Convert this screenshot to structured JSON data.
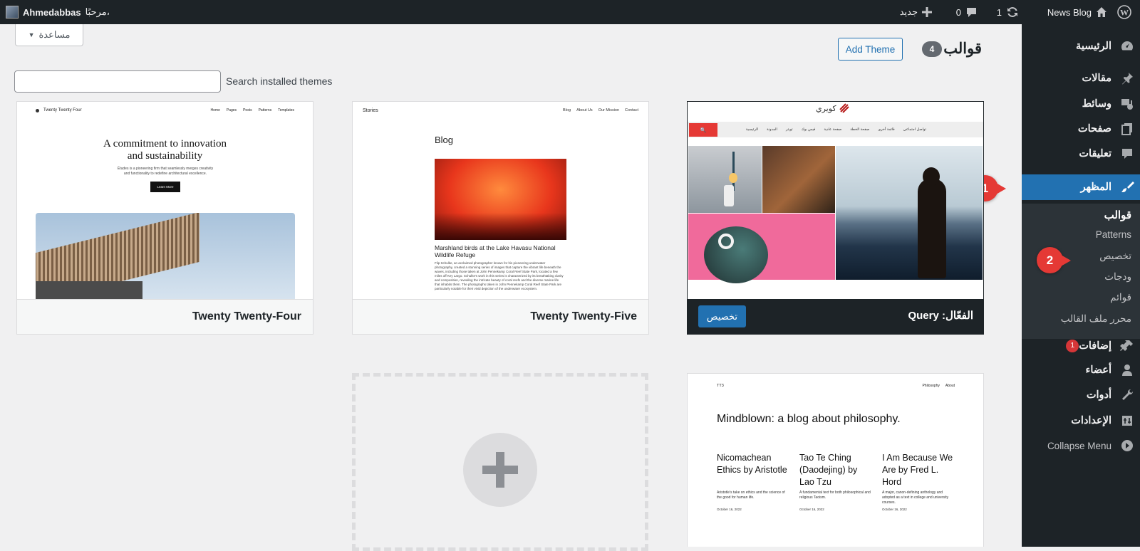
{
  "adminbar": {
    "wp_logo": "wordpress-logo-icon",
    "site_name": "News Blog",
    "updates": "1",
    "comments": "0",
    "new_label": "جديد",
    "greeting": "مرحبًا،",
    "username": "Ahmedabbas"
  },
  "sidebar": {
    "items": [
      {
        "label": "الرئيسية",
        "icon": "dashboard-icon"
      },
      {
        "label": "مقالات",
        "icon": "pin-icon"
      },
      {
        "label": "وسائط",
        "icon": "media-icon"
      },
      {
        "label": "صفحات",
        "icon": "pages-icon"
      },
      {
        "label": "تعليقات",
        "icon": "comments-icon"
      },
      {
        "label": "المظهر",
        "icon": "brush-icon"
      },
      {
        "label": "إضافات",
        "icon": "plugins-icon",
        "badge": "1"
      },
      {
        "label": "أعضاء",
        "icon": "users-icon"
      },
      {
        "label": "أدوات",
        "icon": "tools-icon"
      },
      {
        "label": "الإعدادات",
        "icon": "settings-icon"
      },
      {
        "label": "Collapse Menu",
        "icon": "collapse-icon"
      }
    ],
    "submenu": [
      "قوالب",
      "Patterns",
      "تخصيص",
      "ودجات",
      "قوائم",
      "محرر ملف القالب"
    ]
  },
  "callouts": [
    "1",
    "2"
  ],
  "help": "مساعدة",
  "header": {
    "title": "قوالب",
    "count": "4",
    "add_theme": "Add Theme",
    "search_label": "Search installed themes",
    "search_value": ""
  },
  "themes": {
    "active": {
      "prefix": "الفعّال:",
      "name": "Query",
      "customize": "تخصيص",
      "brand": "كويري",
      "nav": [
        "الرئيسية",
        "المدونة",
        "تويتر",
        "فيس بوك",
        "صفحة عادية",
        "صفحة الخطة",
        "قائمة أخرى",
        "تواصل اجتماعي"
      ]
    },
    "tt5": {
      "name": "Twenty Twenty-Five",
      "site": "Stories",
      "nav": [
        "Blog",
        "About Us",
        "Our Mission",
        "Contact"
      ],
      "heading": "Blog",
      "post_title": "Marshland birds at the Lake Havasu National Wildlife Refuge",
      "post_text": "Flip Schulke, an acclaimed photographer known for his pioneering underwater photography, created a stunning series of images that capture the vibrant life beneath the waves, including those taken at John Pennekamp Coral Reef State Park, located a few miles off Key Largo. Schulke's work in this series is characterized by its breathtaking clarity and composition, revealing the intricate beauty of coral reefs and the diverse marine life that inhabits them. The photographs taken in John Pennekamp Coral Reef State Park are particularly notable for their vivid depiction of the underwater ecosystem."
    },
    "tt4": {
      "name": "Twenty Twenty-Four",
      "site": "Twenty Twenty Four",
      "nav": [
        "Home",
        "Pages",
        "Posts",
        "Patterns",
        "Templates"
      ],
      "headline": "A commitment to innovation and sustainability",
      "sub": "Études is a pioneering firm that seamlessly merges creativity and functionality to redefine architectural excellence.",
      "button": "Learn More"
    },
    "tt3": {
      "site": "TT3",
      "nav": [
        "Philosophy",
        "About"
      ],
      "headline": "Mindblown: a blog about philosophy.",
      "posts": [
        {
          "title": "Nicomachean Ethics by Aristotle",
          "text": "Aristotle's take on ethics and the science of the good for human life.",
          "date": "October 16, 2022"
        },
        {
          "title": "Tao Te Ching (Daodejing) by Lao Tzu",
          "text": "A fundamental text for both philosophical and religious Taoism.",
          "date": "October 16, 2022"
        },
        {
          "title": "I Am Because We Are by Fred L. Hord",
          "text": "A major, canon-defining anthology and adopted as a text in college and university courses.",
          "date": "October 16, 2022"
        }
      ]
    }
  }
}
